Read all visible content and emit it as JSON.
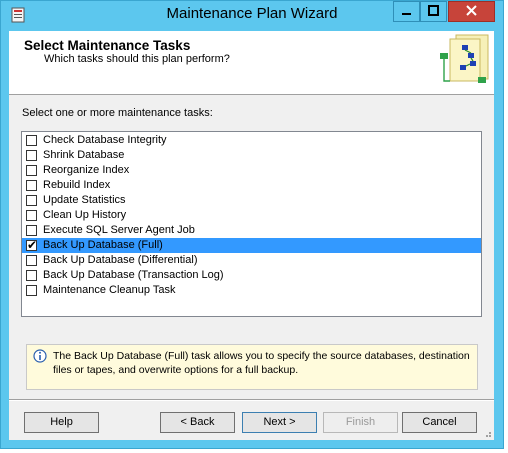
{
  "window": {
    "title": "Maintenance Plan Wizard"
  },
  "header": {
    "title": "Select Maintenance Tasks",
    "subtitle": "Which tasks should this plan perform?"
  },
  "prompt": "Select one or more maintenance tasks:",
  "tasks": [
    {
      "label": "Check Database Integrity",
      "checked": false,
      "selected": false
    },
    {
      "label": "Shrink Database",
      "checked": false,
      "selected": false
    },
    {
      "label": "Reorganize Index",
      "checked": false,
      "selected": false
    },
    {
      "label": "Rebuild Index",
      "checked": false,
      "selected": false
    },
    {
      "label": "Update Statistics",
      "checked": false,
      "selected": false
    },
    {
      "label": "Clean Up History",
      "checked": false,
      "selected": false
    },
    {
      "label": "Execute SQL Server Agent Job",
      "checked": false,
      "selected": false
    },
    {
      "label": "Back Up Database (Full)",
      "checked": true,
      "selected": true
    },
    {
      "label": "Back Up Database (Differential)",
      "checked": false,
      "selected": false
    },
    {
      "label": "Back Up Database (Transaction Log)",
      "checked": false,
      "selected": false
    },
    {
      "label": "Maintenance Cleanup Task",
      "checked": false,
      "selected": false
    }
  ],
  "info": {
    "icon": "info-icon",
    "text": "The Back Up Database (Full) task allows you to specify the source databases, destination files or tapes, and overwrite options for a full backup."
  },
  "buttons": {
    "help": "Help",
    "back": "< Back",
    "next": "Next >",
    "finish": "Finish",
    "cancel": "Cancel"
  },
  "colors": {
    "title_bar": "#5cc7ee",
    "selection": "#3399ff",
    "info_background": "#fffbdc",
    "close_button": "#c7443a"
  }
}
